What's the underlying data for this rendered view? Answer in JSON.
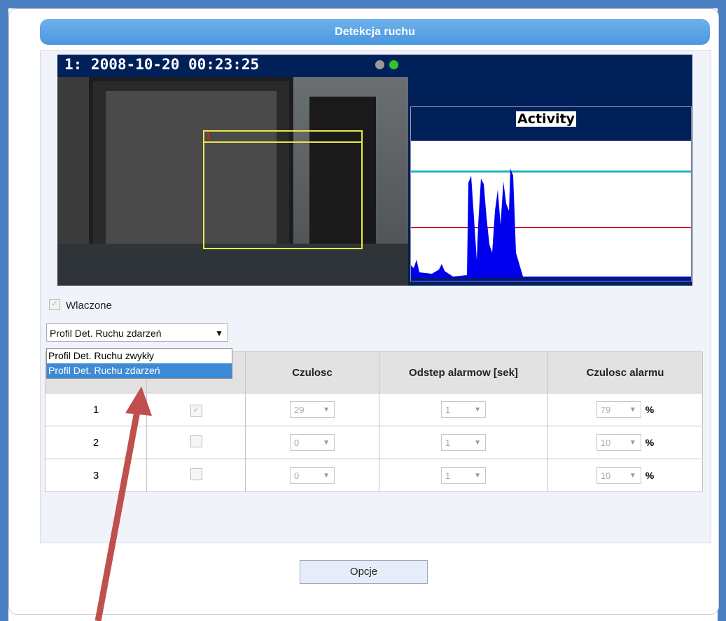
{
  "header": {
    "title": "Detekcja ruchu"
  },
  "video": {
    "camera_timestamp": "1:  2008-10-20 00:23:25",
    "zone_number": "1",
    "status_dot_colors": [
      "#999999",
      "#2ec52e"
    ]
  },
  "activity": {
    "title": "Activity",
    "threshold_high_level": 0.78,
    "threshold_low_level": 0.38,
    "colors": {
      "high": "#27b3bf",
      "low": "#d01919",
      "fill": "#0000ee"
    }
  },
  "enabled": {
    "checked": true,
    "label": "Wlaczone"
  },
  "profile_select": {
    "value": "Profil Det. Ruchu zdarzeń",
    "options": [
      "Profil Det. Ruchu zwykły",
      "Profil Det. Ruchu zdarzeń"
    ],
    "selected_index": 1
  },
  "table": {
    "headers": [
      "",
      "",
      "Czulosc",
      "Odstep alarmow [sek]",
      "Czulosc alarmu"
    ],
    "rows": [
      {
        "id": "1",
        "checked": true,
        "sensitivity": "29",
        "interval": "1",
        "alarm_sensitivity": "79",
        "unit": "%"
      },
      {
        "id": "2",
        "checked": false,
        "sensitivity": "0",
        "interval": "1",
        "alarm_sensitivity": "10",
        "unit": "%"
      },
      {
        "id": "3",
        "checked": false,
        "sensitivity": "0",
        "interval": "1",
        "alarm_sensitivity": "10",
        "unit": "%"
      }
    ]
  },
  "options_button": {
    "label": "Opcje"
  },
  "annotation": {
    "arrow_color": "#c0504d"
  }
}
